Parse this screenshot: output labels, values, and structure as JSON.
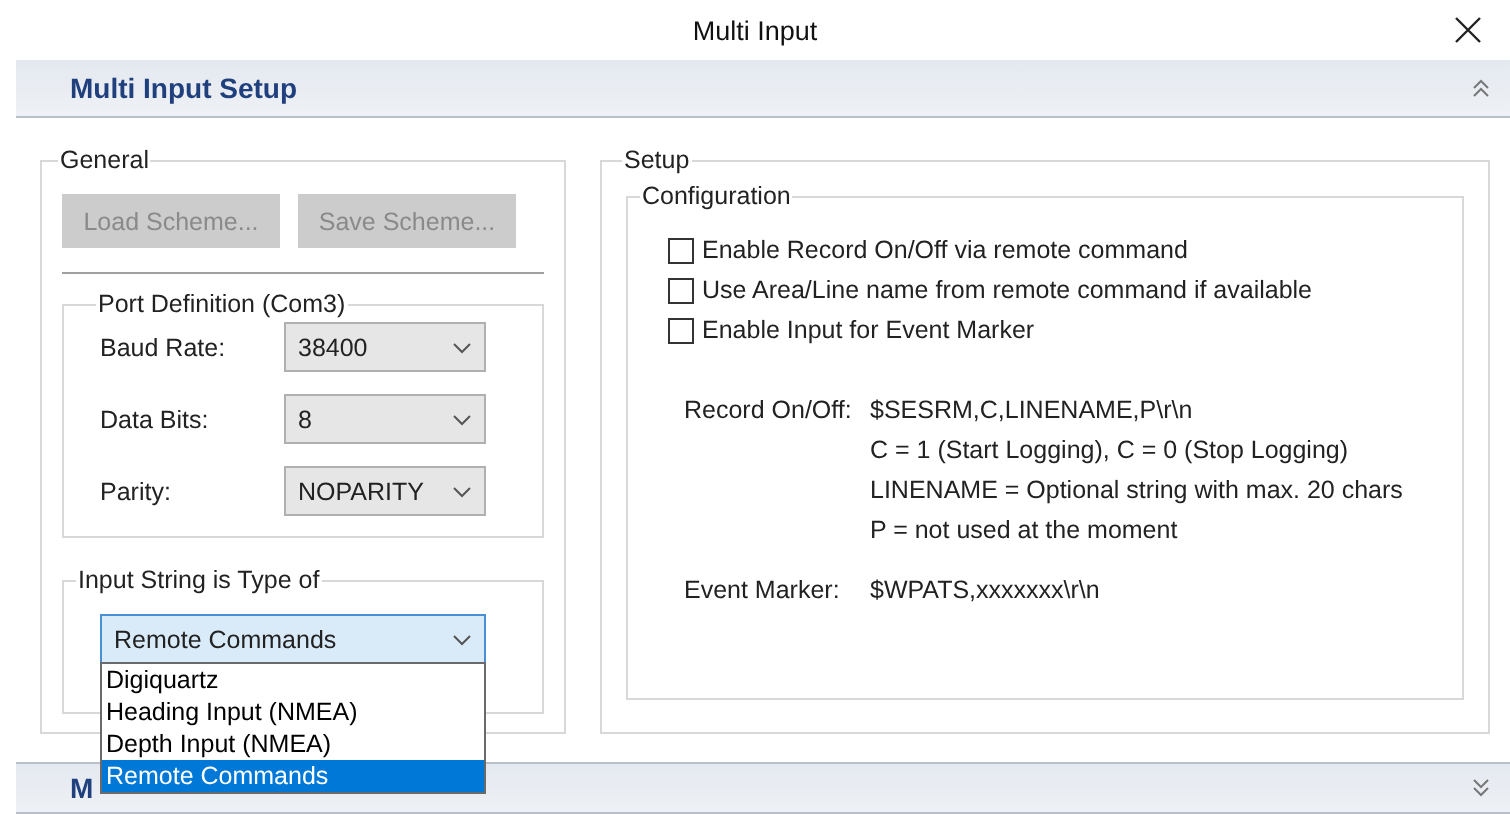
{
  "window": {
    "title": "Multi Input"
  },
  "panel": {
    "title": "Multi Input Setup",
    "expanded": true
  },
  "general": {
    "title": "General",
    "buttons": [
      {
        "label": "Load Scheme...",
        "disabled": true
      },
      {
        "label": "Save Scheme...",
        "disabled": true
      }
    ],
    "port_definition": {
      "title": "Port Definition (Com3)",
      "fields": [
        {
          "label": "Baud Rate:",
          "value": "38400"
        },
        {
          "label": "Data Bits:",
          "value": "8"
        },
        {
          "label": "Parity:",
          "value": "NOPARITY"
        }
      ]
    },
    "input_string": {
      "title": "Input String is Type of",
      "value": "Remote Commands",
      "expanded": true,
      "options": [
        {
          "label": "Digiquartz",
          "selected": false
        },
        {
          "label": "Heading Input (NMEA)",
          "selected": false
        },
        {
          "label": "Depth Input (NMEA)",
          "selected": false
        },
        {
          "label": "Remote Commands",
          "selected": true
        }
      ]
    }
  },
  "setup": {
    "title": "Setup",
    "configuration": {
      "title": "Configuration",
      "checkboxes": [
        {
          "label": "Enable Record On/Off via remote command",
          "checked": false
        },
        {
          "label": "Use Area/Line name from remote command if available",
          "checked": false
        },
        {
          "label": "Enable Input for Event Marker",
          "checked": false
        }
      ],
      "record": {
        "label": "Record On/Off:",
        "lines": [
          "$SESRM,C,LINENAME,P\\r\\n",
          "C = 1 (Start Logging), C = 0 (Stop Logging)",
          "LINENAME = Optional string with max. 20 chars",
          "P = not used at the moment"
        ]
      },
      "event_marker": {
        "label": "Event Marker:",
        "value": "$WPATS,xxxxxxx\\r\\n"
      }
    }
  },
  "second_panel": {
    "title": "M",
    "expanded": false
  }
}
